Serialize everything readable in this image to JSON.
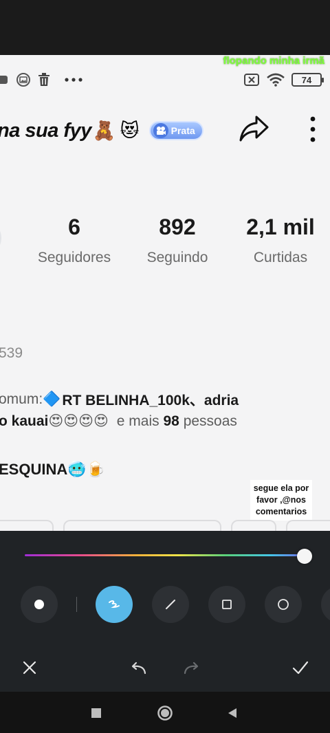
{
  "overlay": {
    "caption": "flopando minha irmã",
    "sticker_text": "segue ela por favor ,@nos comentarios"
  },
  "status_bar": {
    "battery": "74",
    "icons": [
      "photo-notification-icon",
      "image-icon",
      "trash-icon",
      "more-dots-icon",
      "sim-off-icon",
      "wifi-icon"
    ]
  },
  "profile": {
    "name_fragment": "na sua fyy",
    "emoji_1": "🧸",
    "emoji_2": "😻",
    "badge_label": "Prata"
  },
  "stats": [
    {
      "value": "6",
      "label": "Seguidores"
    },
    {
      "value": "892",
      "label": "Seguindo"
    },
    {
      "value": "2,1 mil",
      "label": "Curtidas"
    }
  ],
  "details": {
    "id_fragment": "539",
    "mutual_prefix": "omum:",
    "mutual_emoji": "🔷",
    "mutual_names": "RT BELINHA_100k、adria",
    "mutual_line2_name": "o kauai",
    "mutual_line2_emojis": "😍😍😍😍",
    "mutual_more_prefix": "e mais",
    "mutual_more_count": "98",
    "mutual_more_suffix": "pessoas",
    "bio_text": "ESQUINA",
    "bio_emojis": "🥶🍺"
  },
  "editor": {
    "brush_color": "#ffffff",
    "accent_color": "#58b8e8",
    "tools": [
      "dot-brush-icon",
      "pen-tool-icon",
      "line-tool-icon",
      "rectangle-tool-icon",
      "circle-tool-icon"
    ],
    "active_tool": "pen-tool-icon",
    "slider_level": 1.0
  }
}
